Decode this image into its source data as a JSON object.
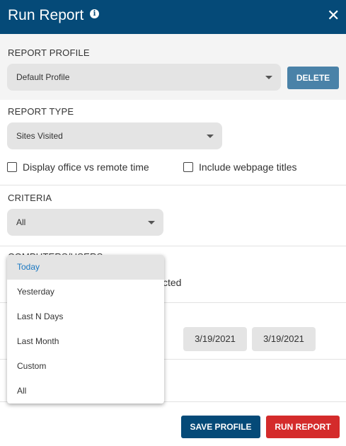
{
  "header": {
    "title": "Run Report",
    "info_icon": "info-icon",
    "close_icon": "close-icon"
  },
  "report_profile": {
    "label": "REPORT PROFILE",
    "selected": "Default Profile",
    "delete_label": "DELETE"
  },
  "report_type": {
    "label": "REPORT TYPE",
    "selected": "Sites Visited",
    "options": [
      {
        "label": "Display office vs remote time",
        "checked": false
      },
      {
        "label": "Include webpage titles",
        "checked": false
      }
    ]
  },
  "criteria": {
    "label": "CRITERIA",
    "selected": "All"
  },
  "computers_users": {
    "label": "COMPUTERS/USERS",
    "partial_text": "cted"
  },
  "date_range": {
    "start_date": "3/19/2021",
    "end_date": "3/19/2021"
  },
  "date_dropdown": {
    "items": [
      "Today",
      "Yesterday",
      "Last N Days",
      "Last Month",
      "Custom",
      "All"
    ],
    "selected": "Today"
  },
  "footer": {
    "save_profile_label": "SAVE PROFILE",
    "run_report_label": "RUN REPORT"
  },
  "colors": {
    "header_bg": "#054a78",
    "delete_button": "#4a82a8",
    "save_button": "#054a78",
    "run_button": "#d42b2b",
    "selected_item_text": "#1a78c2"
  }
}
